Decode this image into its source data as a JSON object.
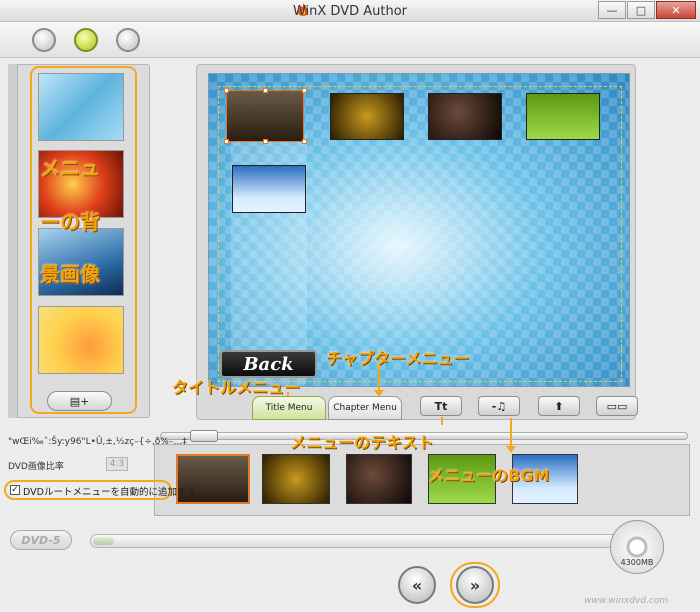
{
  "window": {
    "title": "WinX DVD Author",
    "minimize": "—",
    "maximize": "□",
    "close": "✕"
  },
  "sidebar": {
    "add_label": "▤+",
    "annotation_lines": [
      "メニュ",
      "ーの背",
      "景画像"
    ]
  },
  "preview": {
    "back_label": "Back"
  },
  "tabs": {
    "title_menu": "Title Menu",
    "chapter_menu": "Chapter Menu"
  },
  "tools": {
    "text": "Tt",
    "music": "-♫",
    "up": "⬆",
    "keyboard": "▭▭"
  },
  "annotations": {
    "chapter_menu": "チャプターメニュー",
    "title_menu": "タイトルメニュー",
    "menu_text": "メニューのテキスト",
    "menu_bgm": "メニューのBGM"
  },
  "settings": {
    "garbled_text": "\"wŒi‰ˆ:Šy:y96\"L•Û,±,½zç–{÷,ð%–…‡",
    "ratio_label": "DVD画像比率",
    "ratio_value": "4:3",
    "auto_root_menu_label": "DVDルートメニューを自動的に追加する",
    "auto_root_menu_checked": true
  },
  "footer": {
    "dvd_type": "DVD-5",
    "capacity": "4300MB",
    "used_fraction": 0.04,
    "prev_label": "«",
    "next_label": "»",
    "site": "www.winxdvd.com"
  },
  "colors": {
    "accent": "#f4a81c",
    "selection": "#e07a2a"
  }
}
